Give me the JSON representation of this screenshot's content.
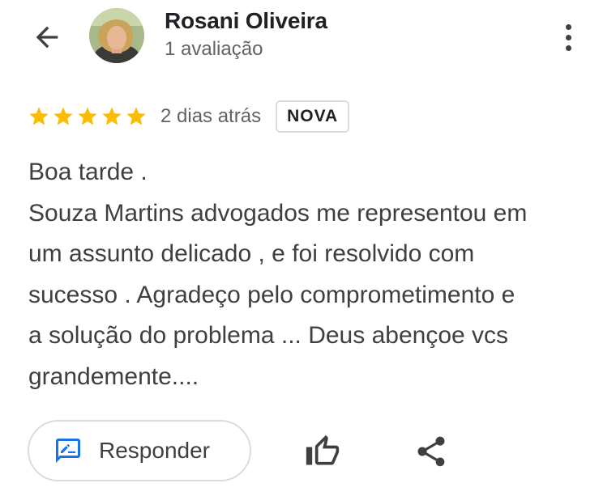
{
  "header": {
    "reviewer_name": "Rosani Oliveira",
    "review_count": "1 avaliação"
  },
  "review": {
    "rating": 5,
    "rating_max": 5,
    "time_ago": "2 dias atrás",
    "badge": "NOVA",
    "lines": [
      "Boa tarde .",
      "Souza Martins advogados me representou em",
      "um assunto delicado , e foi resolvido com",
      "sucesso . Agradeço pelo comprometimento e",
      "a solução do problema ... Deus abençoe vcs",
      "grandemente...."
    ]
  },
  "actions": {
    "reply_label": "Responder"
  },
  "colors": {
    "star": "#fbbc04",
    "reply_icon": "#1a73e8",
    "text": "#3c4043",
    "muted": "#5f6368",
    "border": "#dadce0"
  },
  "icons": {
    "back": "arrow-back-icon",
    "more": "more-vert-icon",
    "reply": "rate-review-icon",
    "like": "thumb-up-icon",
    "share": "share-icon"
  }
}
